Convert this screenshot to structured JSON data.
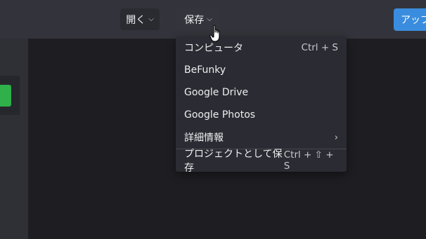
{
  "toolbar": {
    "open_label": "開く",
    "save_label": "保存",
    "upload_label": "アップ",
    "chevron_icon": "chevron-down-icon"
  },
  "save_menu": {
    "items": [
      {
        "label": "コンピュータ",
        "shortcut": "Ctrl + S"
      },
      {
        "label": "BeFunky",
        "shortcut": ""
      },
      {
        "label": "Google Drive",
        "shortcut": ""
      },
      {
        "label": "Google Photos",
        "shortcut": ""
      },
      {
        "label": "詳細情報",
        "shortcut": "",
        "submenu_arrow": "›"
      },
      {
        "label": "プロジェクトとして保存",
        "shortcut": "Ctrl + ⇧ + S"
      }
    ]
  },
  "colors": {
    "accent_blue": "#3a8dde",
    "accent_green": "#2fb04a",
    "menu_bg": "#2b2c33",
    "topbar_bg": "#33343b"
  }
}
